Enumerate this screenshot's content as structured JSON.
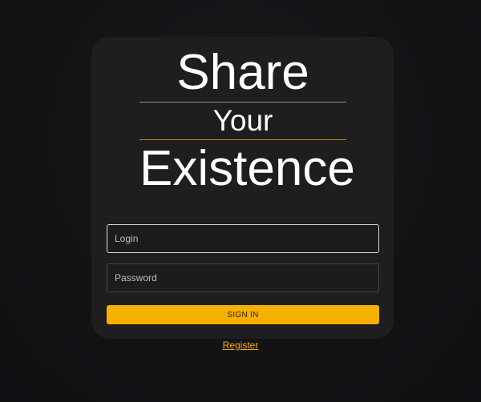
{
  "brand": {
    "line1": "Share",
    "line2": "Your",
    "line3": "Existence"
  },
  "form": {
    "login_placeholder": "Login",
    "password_placeholder": "Password",
    "signin_label": "SIGN IN"
  },
  "footer": {
    "register_label": "Register"
  },
  "colors": {
    "accent": "#f5b000",
    "background": "#121114",
    "card": "#1e1d20"
  }
}
